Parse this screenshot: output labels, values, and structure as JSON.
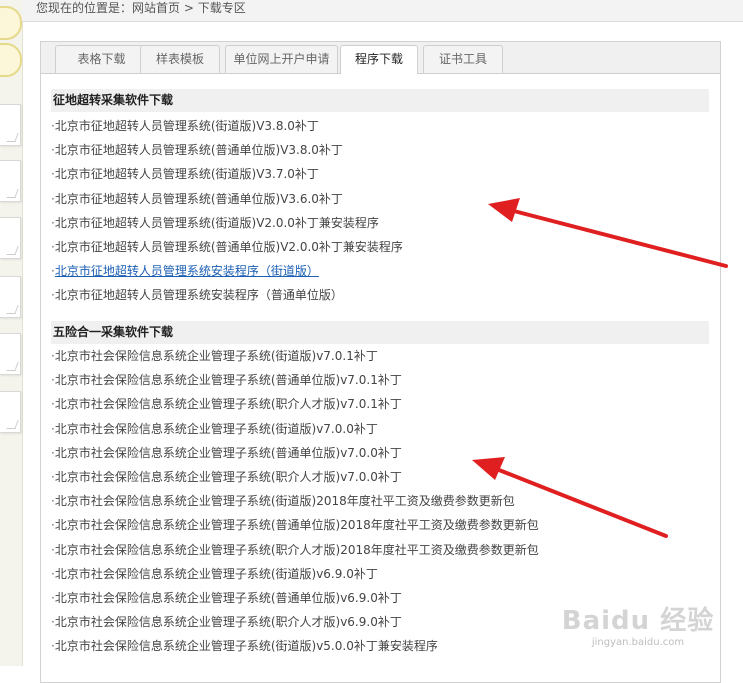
{
  "breadcrumb": {
    "prefix": "您现在的位置是：",
    "home": "网站首页",
    "separator": " > ",
    "current": "下载专区"
  },
  "tabs": [
    {
      "label": "表格下载",
      "active": false
    },
    {
      "label": "样表模板",
      "active": false
    },
    {
      "label": "单位网上开户申请",
      "active": false
    },
    {
      "label": "程序下载",
      "active": true
    },
    {
      "label": "证书工具",
      "active": false
    }
  ],
  "sections": [
    {
      "title": "征地超转采集软件下载",
      "items": [
        "北京市征地超转人员管理系统(街道版)V3.8.0补丁",
        "北京市征地超转人员管理系统(普通单位版)V3.8.0补丁",
        "北京市征地超转人员管理系统(街道版)V3.7.0补丁",
        "北京市征地超转人员管理系统(普通单位版)V3.6.0补丁",
        "北京市征地超转人员管理系统(街道版)V2.0.0补丁兼安装程序",
        "北京市征地超转人员管理系统(普通单位版)V2.0.0补丁兼安装程序",
        "北京市征地超转人员管理系统安装程序（街道版）",
        "北京市征地超转人员管理系统安装程序（普通单位版）"
      ]
    },
    {
      "title": "五险合一采集软件下载",
      "items": [
        "北京市社会保险信息系统企业管理子系统(街道版)v7.0.1补丁",
        "北京市社会保险信息系统企业管理子系统(普通单位版)v7.0.1补丁",
        "北京市社会保险信息系统企业管理子系统(职介人才版)v7.0.1补丁",
        "北京市社会保险信息系统企业管理子系统(街道版)v7.0.0补丁",
        "北京市社会保险信息系统企业管理子系统(普通单位版)v7.0.0补丁",
        "北京市社会保险信息系统企业管理子系统(职介人才版)v7.0.0补丁",
        "北京市社会保险信息系统企业管理子系统(街道版)2018年度社平工资及缴费参数更新包",
        "北京市社会保险信息系统企业管理子系统(普通单位版)2018年度社平工资及缴费参数更新包",
        "北京市社会保险信息系统企业管理子系统(职介人才版)2018年度社平工资及缴费参数更新包",
        "北京市社会保险信息系统企业管理子系统(街道版)v6.9.0补丁",
        "北京市社会保险信息系统企业管理子系统(普通单位版)v6.9.0补丁",
        "北京市社会保险信息系统企业管理子系统(职介人才版)v6.9.0补丁",
        "北京市社会保险信息系统企业管理子系统(街道版)v5.0.0补丁兼安装程序"
      ]
    }
  ],
  "watermark": {
    "brand": "Baidu 经验",
    "url": "jingyan.baidu.com"
  },
  "colors": {
    "arrow": "#e02020",
    "link": "#1a5fb4"
  }
}
